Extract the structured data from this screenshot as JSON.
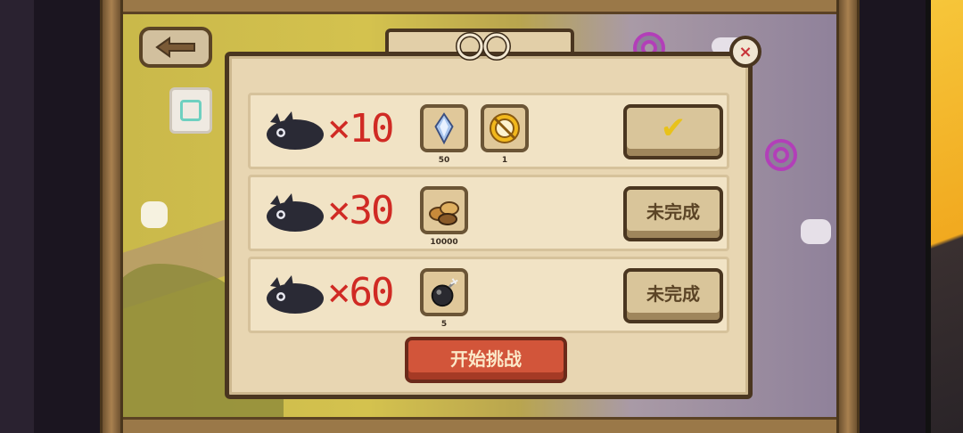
{
  "title": "",
  "close_label": "×",
  "rows": [
    {
      "multiplier": "×10",
      "rewards": [
        {
          "icon": "crystal-icon",
          "count": "50"
        },
        {
          "icon": "golden-medal-icon",
          "count": "1"
        }
      ],
      "status": "✔",
      "completed": true
    },
    {
      "multiplier": "×30",
      "rewards": [
        {
          "icon": "coin-pile-icon",
          "count": "10000"
        }
      ],
      "status": "未完成",
      "completed": false
    },
    {
      "multiplier": "×60",
      "rewards": [
        {
          "icon": "bomb-icon",
          "count": "5"
        }
      ],
      "status": "未完成",
      "completed": false
    }
  ],
  "start_button": "开始挑战",
  "colors": {
    "accent_red": "#d02a24",
    "button_orange": "#d2553a",
    "panel": "#e8d6b2",
    "check_yellow": "#e8c21a"
  }
}
